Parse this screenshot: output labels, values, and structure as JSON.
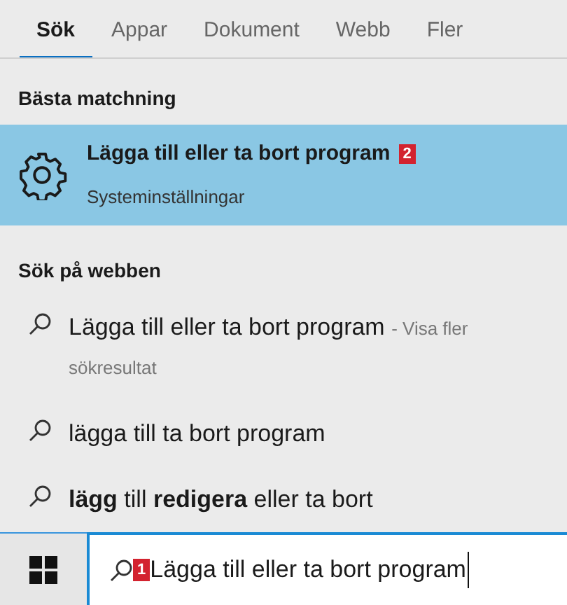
{
  "tabs": [
    {
      "label": "Sök",
      "selected": true
    },
    {
      "label": "Appar",
      "selected": false
    },
    {
      "label": "Dokument",
      "selected": false
    },
    {
      "label": "Webb",
      "selected": false
    },
    {
      "label": "Fler",
      "selected": false
    }
  ],
  "best_match": {
    "heading": "Bästa matchning",
    "title": "Lägga till eller ta bort program",
    "badge": "2",
    "subtitle": "Systeminställningar",
    "selected": true
  },
  "web": {
    "heading": "Sök på webben",
    "results": [
      {
        "text": "Lägga till eller ta bort program",
        "suffix": "- Visa fler sökresultat"
      },
      {
        "text": "lägga till ta bort program"
      },
      {
        "text": "**lägg** till **redigera** eller ta bort"
      }
    ]
  },
  "taskbar": {
    "search": {
      "badge": "1",
      "value": "Lägga till eller ta bort program"
    }
  }
}
